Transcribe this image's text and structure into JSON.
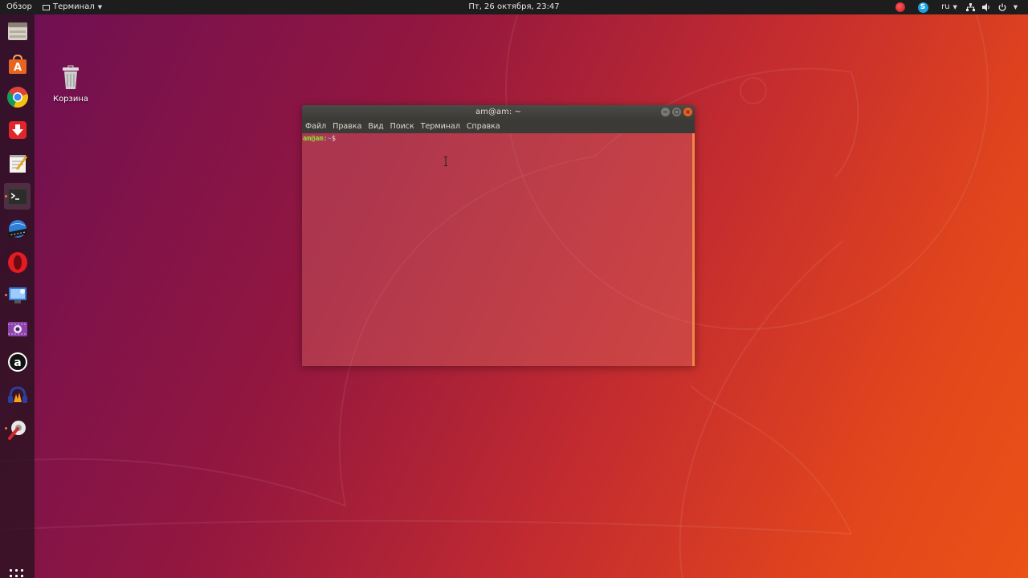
{
  "topbar": {
    "activities": "Обзор",
    "app_menu": "Терминал",
    "clock": "Пт, 26 октября, 23:47",
    "keyboard_layout": "ru",
    "tray_icons": [
      "record-indicator-icon",
      "skype-icon",
      "network-icon",
      "volume-icon",
      "power-icon"
    ]
  },
  "dock": {
    "items": [
      {
        "name": "files",
        "icon": "file-cabinet-icon"
      },
      {
        "name": "software-center",
        "icon": "shopping-bag-icon"
      },
      {
        "name": "chrome",
        "icon": "chrome-icon"
      },
      {
        "name": "downloader",
        "icon": "download-arrow-icon"
      },
      {
        "name": "text-editor",
        "icon": "notepad-icon"
      },
      {
        "name": "terminal",
        "icon": "terminal-icon",
        "active": true
      },
      {
        "name": "video-app",
        "icon": "globe-film-icon"
      },
      {
        "name": "opera",
        "icon": "opera-icon"
      },
      {
        "name": "screen-recorder",
        "icon": "display-settings-icon"
      },
      {
        "name": "webcam-app",
        "icon": "webcam-icon"
      },
      {
        "name": "amarok",
        "icon": "circle-a-icon"
      },
      {
        "name": "audio-app",
        "icon": "headphones-icon"
      },
      {
        "name": "settings-tools",
        "icon": "wrench-gear-icon"
      }
    ],
    "show_apps_icon": "grid-icon"
  },
  "desktop": {
    "trash_label": "Корзина"
  },
  "terminal": {
    "title": "am@am: ~",
    "menu": [
      "Файл",
      "Правка",
      "Вид",
      "Поиск",
      "Терминал",
      "Справка"
    ],
    "prompt_user": "am@am",
    "prompt_sep": ":",
    "prompt_dir": "~",
    "prompt_sign": "$"
  },
  "colors": {
    "accent": "#f15d22",
    "prompt_user": "#8ae234",
    "prompt_dir": "#729fcf",
    "topbar": "#1d1d1d"
  }
}
